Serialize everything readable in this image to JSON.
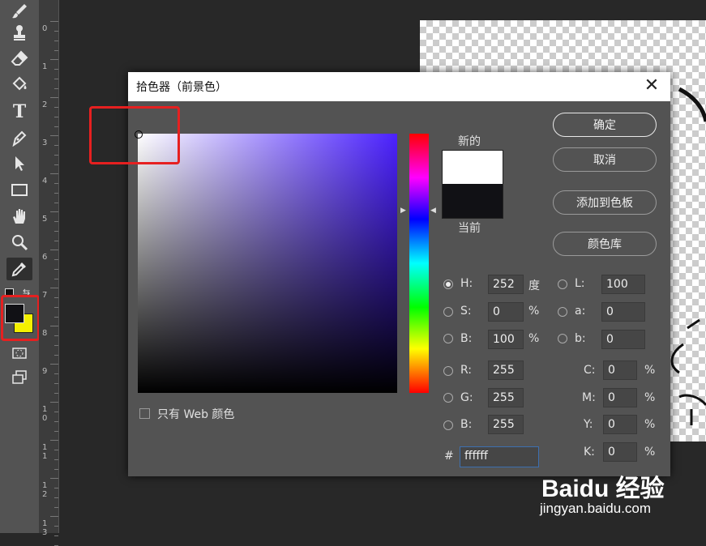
{
  "toolbar": {
    "tools": [
      {
        "icon": "brush-icon"
      },
      {
        "icon": "stamp-icon"
      },
      {
        "icon": "eraser-icon"
      },
      {
        "icon": "paint-bucket-icon"
      },
      {
        "icon": "type-icon",
        "glyph": "T"
      },
      {
        "icon": "pen-icon"
      },
      {
        "icon": "path-select-icon"
      },
      {
        "icon": "rectangle-icon"
      },
      {
        "icon": "hand-icon"
      },
      {
        "icon": "zoom-icon"
      },
      {
        "icon": "eyedropper-icon"
      }
    ],
    "foreground_color": "#111115",
    "background_color": "#f4f000"
  },
  "ruler": {
    "ticks": [
      "0",
      "1",
      "2",
      "3",
      "4",
      "5",
      "6",
      "7",
      "8",
      "9",
      "1\n0",
      "1\n1",
      "1\n2",
      "1\n3"
    ]
  },
  "dialog": {
    "title": "拾色器（前景色）",
    "close_glyph": "✕",
    "new_label": "新的",
    "current_label": "当前",
    "new_color": "#ffffff",
    "current_color": "#111115",
    "hue_color": "#4b21ff",
    "buttons": {
      "ok": "确定",
      "cancel": "取消",
      "add_swatch": "添加到色板",
      "libraries": "颜色库"
    },
    "web_only_label": "只有 Web 颜色",
    "hsb": {
      "h_label": "H:",
      "h_value": "252",
      "h_unit": "度",
      "s_label": "S:",
      "s_value": "0",
      "s_unit": "%",
      "b_label": "B:",
      "b_value": "100",
      "b_unit": "%"
    },
    "lab": {
      "l_label": "L:",
      "l_value": "100",
      "a_label": "a:",
      "a_value": "0",
      "b_label": "b:",
      "b_value": "0"
    },
    "rgb": {
      "r_label": "R:",
      "r_value": "255",
      "g_label": "G:",
      "g_value": "255",
      "b_label": "B:",
      "b_value": "255"
    },
    "cmyk": {
      "c_label": "C:",
      "c_value": "0",
      "m_label": "M:",
      "m_value": "0",
      "y_label": "Y:",
      "y_value": "0",
      "k_label": "K:",
      "k_value": "0",
      "unit": "%"
    },
    "hex_label": "#",
    "hex_value": "ffffff"
  },
  "watermark": {
    "logo": "Baidu 经验",
    "url": "jingyan.baidu.com"
  }
}
